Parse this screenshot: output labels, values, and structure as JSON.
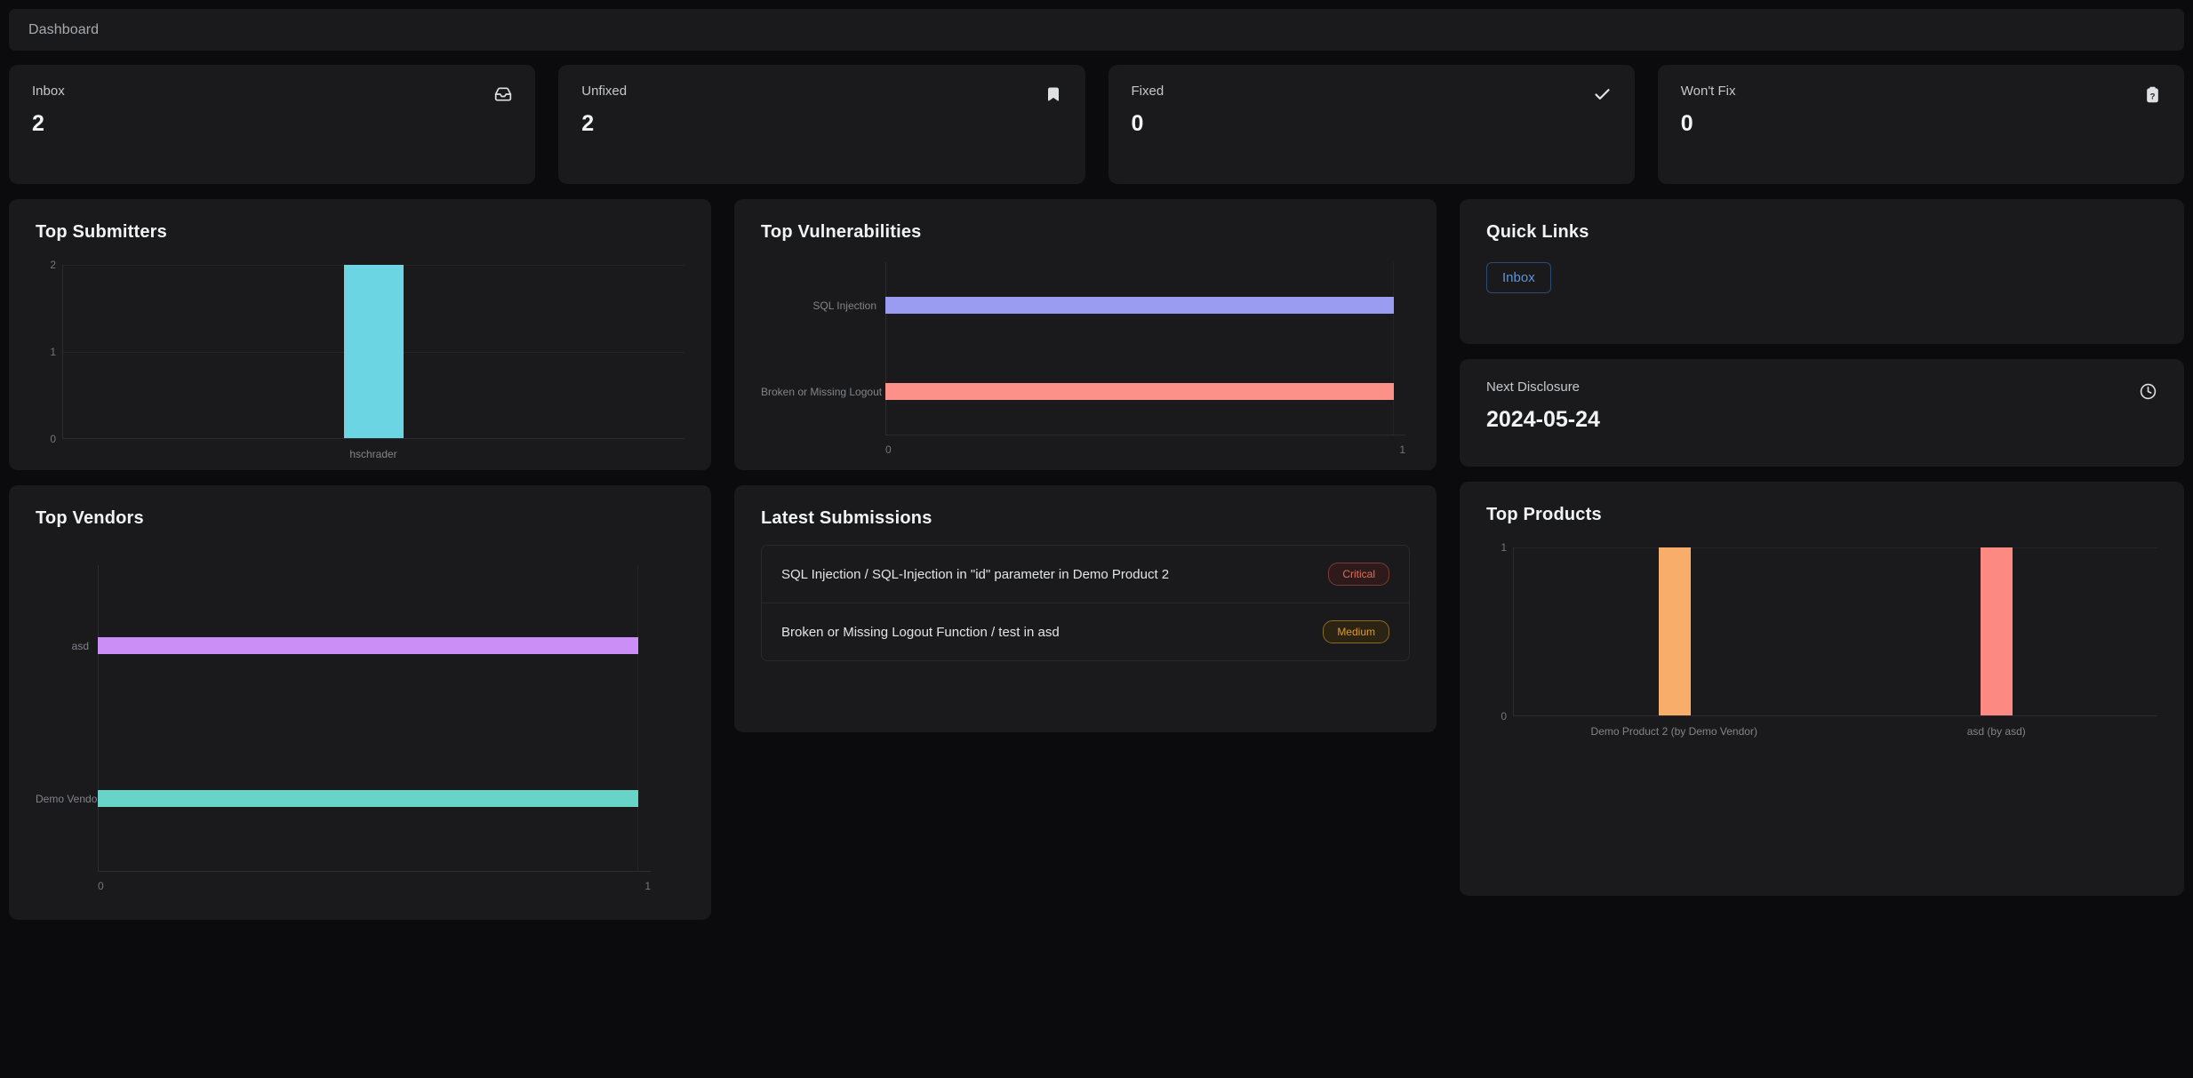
{
  "header": {
    "title": "Dashboard"
  },
  "stats": [
    {
      "label": "Inbox",
      "value": "2",
      "icon": "inbox-icon"
    },
    {
      "label": "Unfixed",
      "value": "2",
      "icon": "bookmark-icon"
    },
    {
      "label": "Fixed",
      "value": "0",
      "icon": "check-icon"
    },
    {
      "label": "Won't Fix",
      "value": "0",
      "icon": "tag-question-icon"
    }
  ],
  "panels": {
    "top_submitters": "Top Submitters",
    "top_vulnerabilities": "Top Vulnerabilities",
    "top_vendors": "Top Vendors",
    "latest_submissions": "Latest Submissions",
    "quick_links": "Quick Links",
    "top_products": "Top Products"
  },
  "quick_links": {
    "buttons": [
      {
        "label": "Inbox"
      }
    ]
  },
  "next_disclosure": {
    "label": "Next Disclosure",
    "value": "2024-05-24",
    "icon": "clock-icon"
  },
  "latest_submissions": {
    "rows": [
      {
        "text": "SQL Injection / SQL-Injection in \"id\" parameter in Demo Product 2",
        "severity": "Critical",
        "color": "#d9715f",
        "bg": "#2e1a1a",
        "border": "#7a3b32"
      },
      {
        "text": "Broken or Missing Logout Function / test in asd",
        "severity": "Medium",
        "color": "#e09a24",
        "bg": "#2b2314",
        "border": "#8a6c1e"
      }
    ]
  },
  "chart_data": [
    {
      "id": "top_submitters",
      "type": "bar",
      "orientation": "vertical",
      "title": "Top Submitters",
      "categories": [
        "hschrader"
      ],
      "values": [
        2
      ],
      "colors": [
        "#6bd5e4"
      ],
      "yticks": [
        "2",
        "1",
        "0"
      ],
      "ylim": [
        0,
        2
      ],
      "xlabel": "",
      "ylabel": "",
      "grid": true
    },
    {
      "id": "top_vulnerabilities",
      "type": "bar",
      "orientation": "horizontal",
      "title": "Top Vulnerabilities",
      "categories": [
        "SQL Injection",
        "Broken or Missing Logout Function"
      ],
      "values": [
        1,
        1
      ],
      "colors": [
        "#9a9cf2",
        "#fc9189"
      ],
      "xticks": [
        "0",
        "1"
      ],
      "xlim": [
        0,
        1
      ],
      "xlabel": "",
      "ylabel": "",
      "grid": true
    },
    {
      "id": "top_vendors",
      "type": "bar",
      "orientation": "horizontal",
      "title": "Top Vendors",
      "categories": [
        "asd",
        "Demo Vendor"
      ],
      "values": [
        1,
        1
      ],
      "colors": [
        "#cb8ef7",
        "#68d3c7"
      ],
      "xticks": [
        "0",
        "1"
      ],
      "xlim": [
        0,
        1
      ],
      "xlabel": "",
      "ylabel": "",
      "grid": true
    },
    {
      "id": "top_products",
      "type": "bar",
      "orientation": "vertical",
      "title": "Top Products",
      "categories": [
        "Demo Product 2 (by Demo Vendor)",
        "asd (by asd)"
      ],
      "values": [
        1,
        1
      ],
      "colors": [
        "#f8ad6a",
        "#fc8a83"
      ],
      "yticks": [
        "1",
        "0"
      ],
      "ylim": [
        0,
        1
      ],
      "xlabel": "",
      "ylabel": "",
      "grid": true
    }
  ]
}
